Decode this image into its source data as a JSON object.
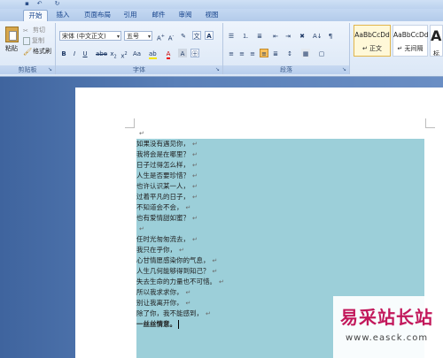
{
  "tabs": [
    "开始",
    "插入",
    "页面布局",
    "引用",
    "邮件",
    "审阅",
    "视图"
  ],
  "clipboard": {
    "paste": "粘贴",
    "cut": "剪切",
    "copy": "复制",
    "format_painter": "格式刷",
    "group": "剪贴板"
  },
  "font": {
    "name": "宋体 (中文正文)",
    "size": "五号",
    "group": "字体"
  },
  "paragraph": {
    "group": "段落"
  },
  "styles": [
    {
      "sample": "AaBbCcDd",
      "name": "↵ 正文"
    },
    {
      "sample": "AaBbCcDd",
      "name": "↵ 无间隔"
    },
    {
      "sample": "Aa",
      "name": "标"
    }
  ],
  "document": {
    "lines": [
      "如果没有遇见你，",
      "我将会是在哪里？",
      "日子过得怎么样，",
      "人生是否要珍惜？",
      "也许认识某一人，",
      "过着平凡的日子，",
      "不知道会不会，",
      "也有爱情甜如蜜？",
      "",
      "任时光匆匆流去，",
      "我只在乎你，",
      "心甘情愿感染你的气息，",
      "人生几何能够得到知己？",
      "失去生命的力量也不可惜。",
      "所以我求求你，",
      "别让我离开你，",
      "除了你，我不能感到，",
      "一丝丝情意。"
    ],
    "mark": "↵"
  },
  "watermark": {
    "title": "易采站长站",
    "url": "www.easck.com"
  },
  "colors": {
    "selection": "#9ccfd9",
    "ribbon_text": "#15428b",
    "watermark": "#c2185b"
  }
}
